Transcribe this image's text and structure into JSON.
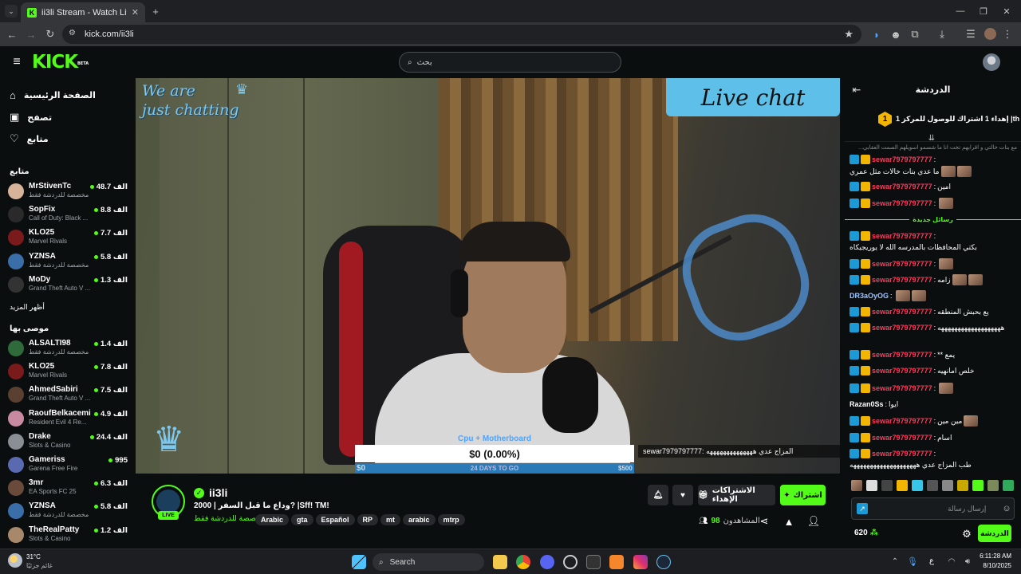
{
  "browser": {
    "tab_title": "ii3li Stream - Watch Live on Kick",
    "url": "kick.com/ii3li"
  },
  "header": {
    "logo": "KICK",
    "logo_badge": "BETA",
    "search_placeholder": "بحث"
  },
  "sidebar": {
    "nav": [
      {
        "label": "الصفحة الرئيسية",
        "icon": "home-icon"
      },
      {
        "label": "تصفح",
        "icon": "browse-icon"
      },
      {
        "label": "متابع",
        "icon": "heart-icon"
      }
    ],
    "following_title": "متابع",
    "following": [
      {
        "name": "MrStivenTc",
        "sub": "مخصصة للدردشة فقط",
        "viewers": "48.7 الف",
        "color": "#d6b39a"
      },
      {
        "name": "SopFix",
        "sub": "Call of Duty: Black ...",
        "viewers": "8.8 الف",
        "color": "#2a2a2a"
      },
      {
        "name": "KLO25",
        "sub": "Marvel Rivals",
        "viewers": "7.7 الف",
        "color": "#7a1a1a"
      },
      {
        "name": "YZNSA",
        "sub": "مخصصة للدردشة فقط",
        "viewers": "5.8 الف",
        "color": "#3a6ea8"
      },
      {
        "name": "MoDy",
        "sub": "Grand Theft Auto V ...",
        "viewers": "1.3 الف",
        "color": "#333"
      }
    ],
    "show_more": "أظهر المزيد",
    "recommended_title": "موصى بها",
    "recommended": [
      {
        "name": "ALSALTI98",
        "sub": "مخصصة للدردشة فقط",
        "viewers": "1.4 الف",
        "color": "#2f6b3a"
      },
      {
        "name": "KLO25",
        "sub": "Marvel Rivals",
        "viewers": "7.8 الف",
        "color": "#7a1a1a"
      },
      {
        "name": "AhmedSabiri",
        "sub": "Grand Theft Auto V ...",
        "viewers": "7.5 الف",
        "color": "#5a4030"
      },
      {
        "name": "RaoufBelkacemi",
        "sub": "Resident Evil 4 Re...",
        "viewers": "4.9 الف",
        "color": "#c88aa0"
      },
      {
        "name": "Drake",
        "sub": "Slots & Casino",
        "viewers": "24.4 الف",
        "color": "#8a8f96"
      },
      {
        "name": "Gameriss",
        "sub": "Garena Free Fire",
        "viewers": "995",
        "color": "#5a6ab0"
      },
      {
        "name": "3mr",
        "sub": "EA Sports FC 25",
        "viewers": "6.3 الف",
        "color": "#6a4a3a"
      },
      {
        "name": "YZNSA",
        "sub": "مخصصة للدردشة فقط",
        "viewers": "5.8 الف",
        "color": "#3a6ea8"
      },
      {
        "name": "TheRealPatty",
        "sub": "Slots & Casino",
        "viewers": "1.2 الف",
        "color": "#a8886a"
      }
    ]
  },
  "video": {
    "overlay_left": "We are\njust chatting",
    "overlay_right": "Live chat",
    "donation_top": "Cpu + Motherboard",
    "donation_amount": "$0 (0.00%)",
    "donation_start": "$0",
    "donation_days": "24 DAYS TO GO",
    "donation_end": "$500",
    "ticker": "sewar7979797777: المزاج عدي ههههههههههههههه"
  },
  "stream": {
    "channel": "ii3li",
    "live_badge": "LIVE",
    "title": "وداع ما قبل السفر | 2000? |Sff! TM!",
    "category": "مخصصة للدردشة فقط",
    "tags": [
      "Arabic",
      "gta",
      "Español",
      "RP",
      "mt",
      "arabic",
      "mtrp"
    ],
    "subscribe": "اشتراك",
    "gift": "الاشتراكات الإهداء",
    "viewers_label": "المشاهدون",
    "viewers": "98"
  },
  "chat": {
    "title": "الدردشة",
    "pinned": "إهداء 1 اشتراك للوصول للمركز 1 |th",
    "pinned_rank": "1",
    "new_messages": "رسائل جديدة",
    "truncated_top": "...مع بنات خالتي و اقرابهم تخت انا ما شسمو اسويلهم الصمت العقابي",
    "messages": [
      {
        "user": "sewar7979797777",
        "text": "ما عدي بنات خالات مثل عمري",
        "emotes": 2,
        "color": "#ff3b5c"
      },
      {
        "user": "sewar7979797777",
        "text": "امين",
        "emotes": 0,
        "color": "#ff3b5c"
      },
      {
        "user": "sewar7979797777",
        "text": "",
        "emotes": 1,
        "color": "#ff3b5c"
      },
      {
        "user": "sewar7979797777",
        "text": "بكتي المحافظات بالمدرسه الله لا يوريجيكاه",
        "emotes": 0,
        "color": "#ff3b5c"
      },
      {
        "user": "sewar7979797777",
        "text": "",
        "emotes": 1,
        "color": "#ff3b5c"
      },
      {
        "user": "sewar7979797777",
        "text": "زامه",
        "emotes": 2,
        "color": "#ff3b5c"
      },
      {
        "user": "DR3aOyOG",
        "text": "",
        "emotes": 2,
        "color": "#9fc5ff"
      },
      {
        "user": "sewar7979797777",
        "text": "يع بحبش المنطقه",
        "emotes": 0,
        "color": "#ff3b5c"
      },
      {
        "user": "sewar7979797777",
        "text": "هههههههههههههههههههه",
        "emotes": 0,
        "color": "#ff3b5c"
      },
      {
        "user": "sewar7979797777",
        "text": "** يمع",
        "emotes": 0,
        "color": "#ff3b5c"
      },
      {
        "user": "sewar7979797777",
        "text": "خلص امانهيه",
        "emotes": 0,
        "color": "#ff3b5c"
      },
      {
        "user": "sewar7979797777",
        "text": "",
        "emotes": 1,
        "color": "#ff3b5c"
      },
      {
        "user": "Razan0Ss",
        "text": "ايوا",
        "emotes": 0,
        "color": "#ffffff"
      },
      {
        "user": "sewar7979797777",
        "text": "مين مين",
        "emotes": 1,
        "color": "#ff3b5c"
      },
      {
        "user": "sewar7979797777",
        "text": "اسام",
        "emotes": 0,
        "color": "#ff3b5c"
      },
      {
        "user": "sewar7979797777",
        "text": "طب المزاج عدي ههههههههههههههههههههه",
        "emotes": 0,
        "color": "#ff3b5c"
      }
    ],
    "input_placeholder": "إرسال رسالة",
    "send_button": "الدردشة",
    "points": "620"
  },
  "taskbar": {
    "weather_temp": "31°C",
    "weather_desc": "غائم جزئيًا",
    "search": "Search",
    "time": "6:11:28 AM",
    "date": "8/10/2025",
    "lang": "ع"
  }
}
